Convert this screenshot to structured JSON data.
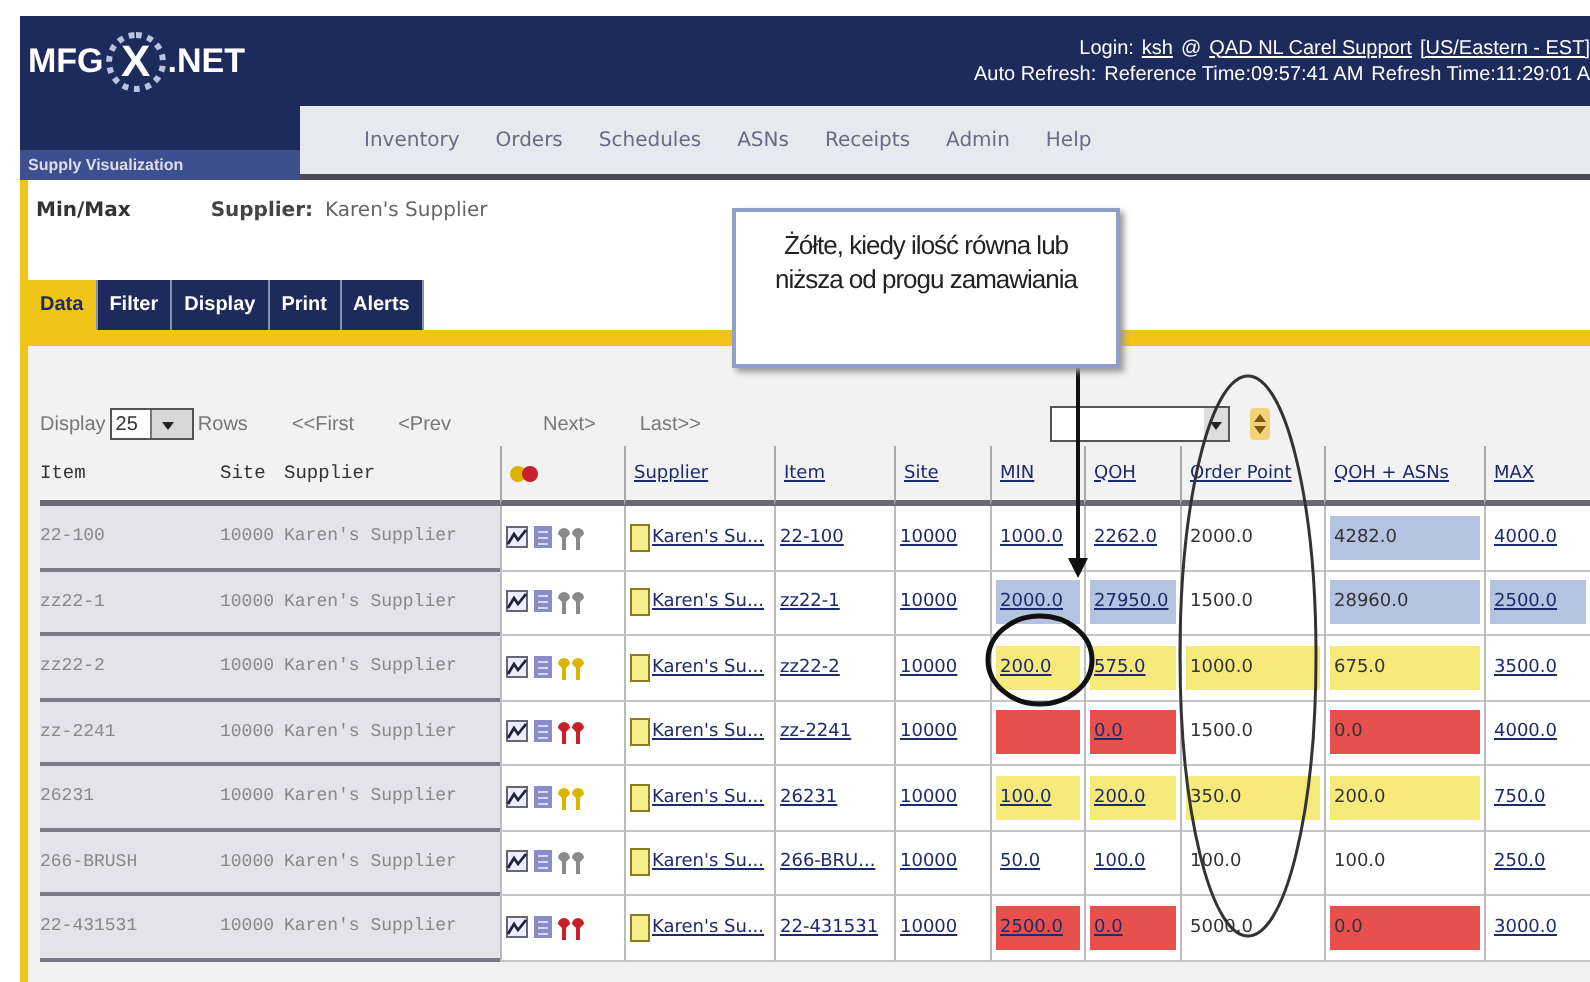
{
  "header": {
    "logo": {
      "left": "MFG",
      "mark": "X",
      "right": ".NET",
      "tagline": "Supply Visualization"
    },
    "login": {
      "label": "Login:",
      "user": "ksh",
      "at": "@",
      "site": "QAD NL Carel Support",
      "zone": "[US/Eastern - EST]"
    },
    "refresh": {
      "auto": "Auto Refresh:",
      "reference": "Reference Time:09:57:41 AM",
      "refresh": "Refresh Time:11:29:01 A"
    },
    "nav": [
      "Inventory",
      "Orders",
      "Schedules",
      "ASNs",
      "Receipts",
      "Admin",
      "Help"
    ]
  },
  "page": {
    "title": "Min/Max",
    "supplier_label": "Supplier:",
    "supplier": "Karen's Supplier"
  },
  "tabs": [
    {
      "label": "Data",
      "selected": true
    },
    {
      "label": "Filter",
      "selected": false
    },
    {
      "label": "Display",
      "selected": false
    },
    {
      "label": "Print",
      "selected": false
    },
    {
      "label": "Alerts",
      "selected": false
    }
  ],
  "pager": {
    "display": "Display",
    "rows_value": "25",
    "rows": "Rows",
    "first": "<<First",
    "prev": "<Prev",
    "next": "Next>",
    "last": "Last>>"
  },
  "table": {
    "columns": [
      {
        "label": "Item",
        "kind": "plain"
      },
      {
        "label": "Site",
        "kind": "plain"
      },
      {
        "label": "Supplier",
        "kind": "plain"
      },
      {
        "kind": "icon"
      },
      {
        "label": "Supplier",
        "kind": "link"
      },
      {
        "label": "Item",
        "kind": "link"
      },
      {
        "label": "Site",
        "kind": "link"
      },
      {
        "label": "MIN",
        "kind": "link"
      },
      {
        "label": "QOH",
        "kind": "link"
      },
      {
        "label": "Order Point",
        "kind": "link"
      },
      {
        "label": "QOH + ASNs",
        "kind": "link"
      },
      {
        "label": "MAX",
        "kind": "link"
      }
    ],
    "rows": [
      {
        "item": "22-100",
        "site": "10000",
        "supplier": "Karen's Supplier",
        "color": "#8a8a8a",
        "supplier_link": "Karen's Su...",
        "item_link": "22-100",
        "site_link": "10000",
        "values": [
          {
            "text": "1000.0",
            "color": "#ffffff",
            "link": true
          },
          {
            "text": "2262.0",
            "color": "#ffffff",
            "link": true
          },
          {
            "text": "2000.0",
            "color": "#ffffff",
            "link": false
          },
          {
            "text": "4282.0",
            "color": "#b4c3df",
            "link": false
          },
          {
            "text": "4000.0",
            "color": "#ffffff",
            "link": true
          }
        ]
      },
      {
        "item": "zz22-1",
        "site": "10000",
        "supplier": "Karen's Supplier",
        "color": "#8a8a8a",
        "supplier_link": "Karen's Su...",
        "item_link": "zz22-1",
        "site_link": "10000",
        "values": [
          {
            "text": "2000.0",
            "color": "#b4c3df",
            "link": true
          },
          {
            "text": "27950.0",
            "color": "#b4c3df",
            "link": true
          },
          {
            "text": "1500.0",
            "color": "#ffffff",
            "link": false
          },
          {
            "text": "28960.0",
            "color": "#b4c3df",
            "link": false
          },
          {
            "text": "2500.0",
            "color": "#b4c3df",
            "link": true
          }
        ]
      },
      {
        "item": "zz22-2",
        "site": "10000",
        "supplier": "Karen's Supplier",
        "color": "#d9b400",
        "supplier_link": "Karen's Su...",
        "item_link": "zz22-2",
        "site_link": "10000",
        "values": [
          {
            "text": "200.0",
            "color": "#f6ea7a",
            "link": true
          },
          {
            "text": "575.0",
            "color": "#f6ea7a",
            "link": true
          },
          {
            "text": "1000.0",
            "color": "#f6ea7a",
            "link": false
          },
          {
            "text": "675.0",
            "color": "#f6ea7a",
            "link": false
          },
          {
            "text": "3500.0",
            "color": "#ffffff",
            "link": true
          }
        ]
      },
      {
        "item": "zz-2241",
        "site": "10000",
        "supplier": "Karen's Supplier",
        "color": "#c8202a",
        "supplier_link": "Karen's Su...",
        "item_link": "zz-2241",
        "site_link": "10000",
        "values": [
          {
            "color": "#e8504e"
          },
          {
            "text": "0.0",
            "color": "#e8504e",
            "link": true
          },
          {
            "text": "1500.0",
            "color": "#ffffff",
            "link": false
          },
          {
            "text": "0.0",
            "color": "#e8504e",
            "link": false
          },
          {
            "text": "4000.0",
            "color": "#ffffff",
            "link": true
          }
        ]
      },
      {
        "item": "26231",
        "site": "10000",
        "supplier": "Karen's Supplier",
        "color": "#d9b400",
        "supplier_link": "Karen's Su...",
        "item_link": "26231",
        "site_link": "10000",
        "values": [
          {
            "text": "100.0",
            "color": "#f6ea7a",
            "link": true
          },
          {
            "text": "200.0",
            "color": "#f6ea7a",
            "link": true
          },
          {
            "text": "350.0",
            "color": "#f6ea7a",
            "link": false
          },
          {
            "text": "200.0",
            "color": "#f6ea7a",
            "link": false
          },
          {
            "text": "750.0",
            "color": "#ffffff",
            "link": true
          }
        ]
      },
      {
        "item": "266-BRUSH",
        "site": "10000",
        "supplier": "Karen's Supplier",
        "color": "#8a8a8a",
        "supplier_link": "Karen's Su...",
        "item_link": "266-BRU...",
        "site_link": "10000",
        "values": [
          {
            "text": "50.0",
            "color": "#ffffff",
            "link": true
          },
          {
            "text": "100.0",
            "color": "#ffffff",
            "link": true
          },
          {
            "text": "100.0",
            "color": "#ffffff",
            "link": false
          },
          {
            "text": "100.0",
            "color": "#ffffff",
            "link": false
          },
          {
            "text": "250.0",
            "color": "#ffffff",
            "link": true
          }
        ]
      },
      {
        "item": "22-431531",
        "site": "10000",
        "supplier": "Karen's Supplier",
        "color": "#c8202a",
        "supplier_link": "Karen's Su...",
        "item_link": "22-431531",
        "site_link": "10000",
        "values": [
          {
            "text": "2500.0",
            "color": "#e8504e",
            "link": true
          },
          {
            "text": "0.0",
            "color": "#e8504e",
            "link": true
          },
          {
            "text": "5000.0",
            "color": "#ffffff",
            "link": false
          },
          {
            "text": "0.0",
            "color": "#e8504e",
            "link": false
          },
          {
            "text": "3000.0",
            "color": "#ffffff",
            "link": true
          }
        ]
      }
    ]
  },
  "annotation": {
    "text": "Żółte, kiedy ilość równa lub niższa od progu zamawiania"
  }
}
